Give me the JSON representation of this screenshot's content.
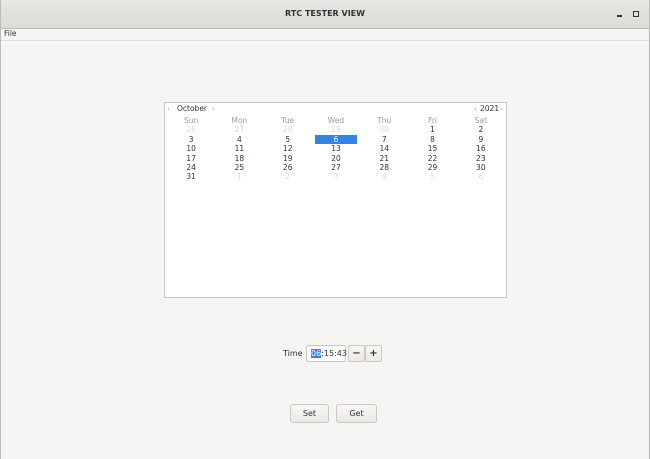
{
  "window": {
    "title": "RTC TESTER VIEW",
    "min_icon": "minimize-icon",
    "max_icon": "maximize-icon"
  },
  "menu": {
    "items": [
      "File"
    ]
  },
  "calendar": {
    "month": "October",
    "year": "2021",
    "weekdays": [
      "Sun",
      "Mon",
      "Tue",
      "Wed",
      "Thu",
      "Fri",
      "Sat"
    ],
    "selected_day": "6",
    "weeks": [
      [
        "26",
        "27",
        "28",
        "29",
        "30",
        "1",
        "2"
      ],
      [
        "3",
        "4",
        "5",
        "6",
        "7",
        "8",
        "9"
      ],
      [
        "10",
        "11",
        "12",
        "13",
        "14",
        "15",
        "16"
      ],
      [
        "17",
        "18",
        "19",
        "20",
        "21",
        "22",
        "23"
      ],
      [
        "24",
        "25",
        "26",
        "27",
        "28",
        "29",
        "30"
      ],
      [
        "31",
        "1",
        "2",
        "3",
        "4",
        "5",
        "6"
      ]
    ],
    "outside": [
      [
        true,
        true,
        true,
        true,
        true,
        false,
        false
      ],
      [
        false,
        false,
        false,
        false,
        false,
        false,
        false
      ],
      [
        false,
        false,
        false,
        false,
        false,
        false,
        false
      ],
      [
        false,
        false,
        false,
        false,
        false,
        false,
        false
      ],
      [
        false,
        false,
        false,
        false,
        false,
        false,
        false
      ],
      [
        false,
        true,
        true,
        true,
        true,
        true,
        true
      ]
    ]
  },
  "time": {
    "label": "Time",
    "hour_selected": "06",
    "rest": ":15:43",
    "minus_label": "−",
    "plus_label": "+"
  },
  "buttons": {
    "set_label": "Set",
    "get_label": "Get"
  },
  "colors": {
    "accent": "#3584e4"
  }
}
